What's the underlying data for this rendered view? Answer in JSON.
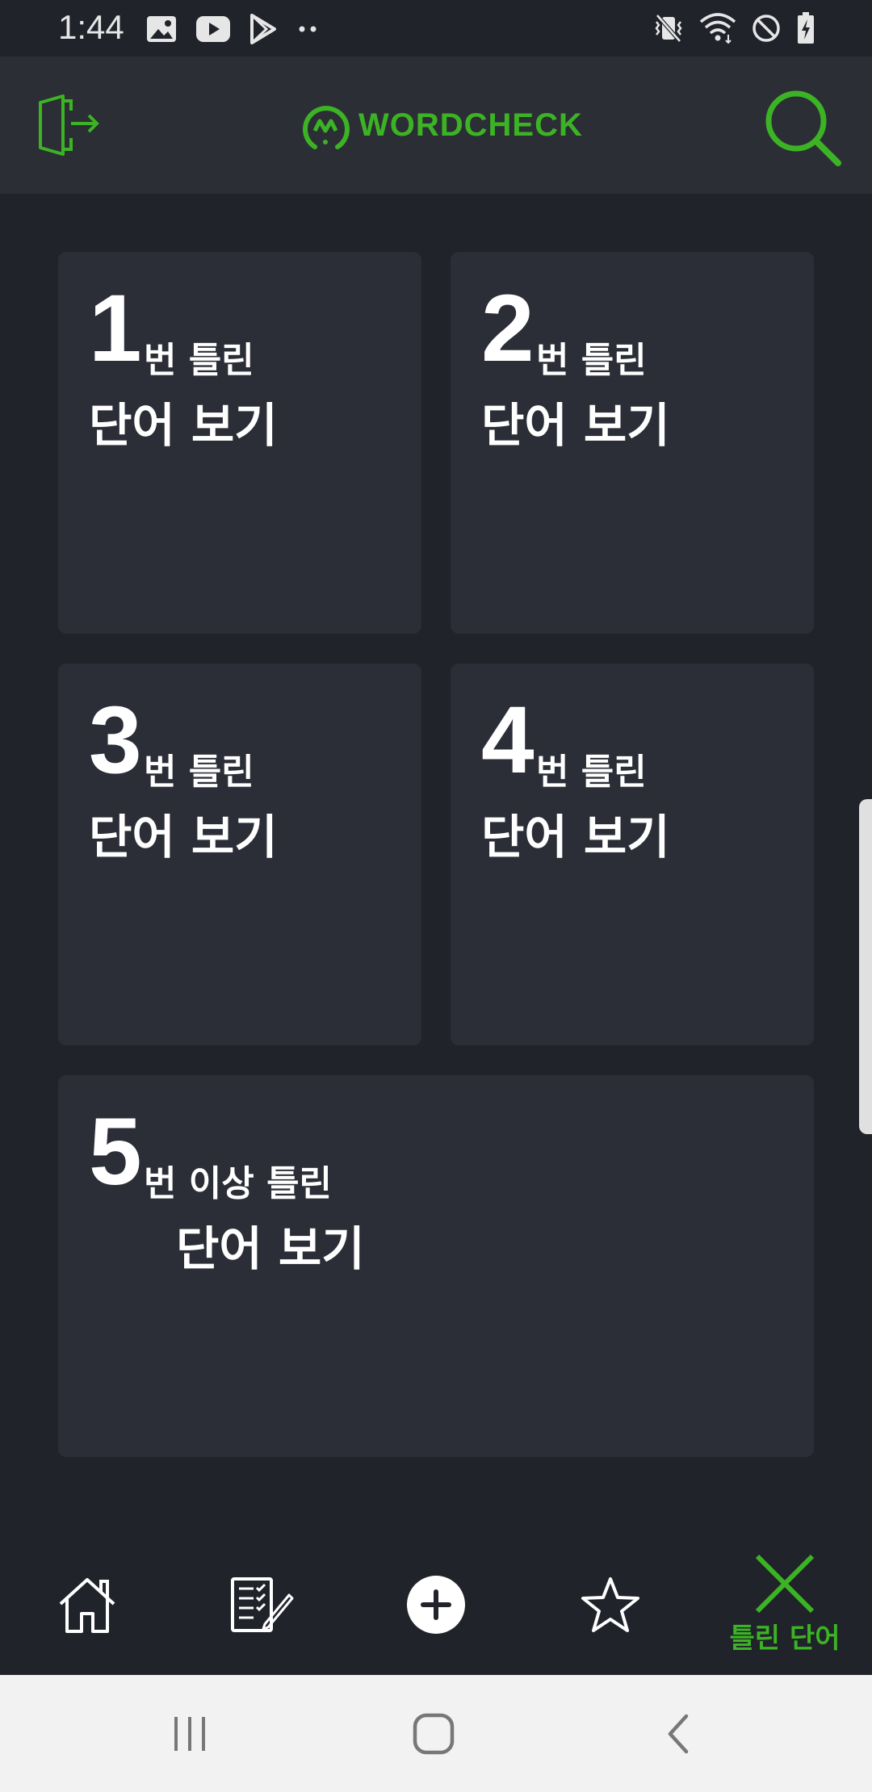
{
  "status_bar": {
    "time": "1:44",
    "left_icons": [
      "gallery-icon",
      "youtube-icon",
      "play-store-icon",
      "more-dots-icon"
    ],
    "right_icons": [
      "vibrate-icon",
      "wifi-icon",
      "do-not-disturb-icon",
      "battery-charging-icon"
    ]
  },
  "header": {
    "logo_text": "WORDCHECK",
    "exit_icon": "exit-icon",
    "search_icon": "search-icon",
    "accent_color": "#3cb324"
  },
  "cards": [
    {
      "number": "1",
      "subtitle": "번 틀린",
      "title": "단어 보기"
    },
    {
      "number": "2",
      "subtitle": "번 틀린",
      "title": "단어 보기"
    },
    {
      "number": "3",
      "subtitle": "번 틀린",
      "title": "단어 보기"
    },
    {
      "number": "4",
      "subtitle": "번 틀린",
      "title": "단어 보기"
    },
    {
      "number": "5",
      "subtitle": "번 이상 틀린",
      "title": "단어 보기"
    }
  ],
  "bottom_nav": {
    "items": [
      {
        "icon": "home-icon",
        "label": ""
      },
      {
        "icon": "checklist-icon",
        "label": ""
      },
      {
        "icon": "add-circle-icon",
        "label": ""
      },
      {
        "icon": "star-icon",
        "label": ""
      },
      {
        "icon": "close-x-icon",
        "label": "틀린 단어",
        "active": true
      }
    ]
  },
  "system_nav": [
    "recent-apps-icon",
    "home-circle-icon",
    "back-icon"
  ]
}
